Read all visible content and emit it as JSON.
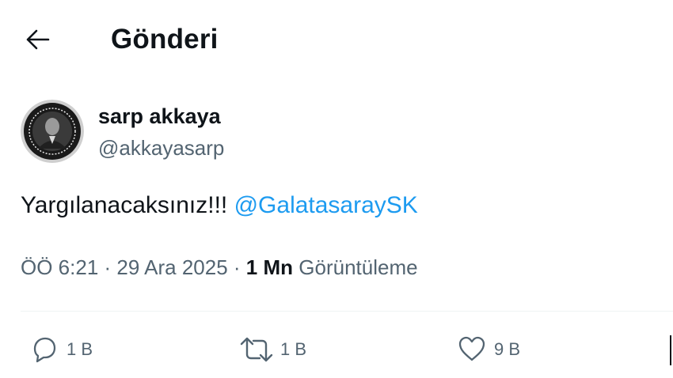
{
  "header": {
    "back_icon": "arrow-left-icon",
    "title": "Gönderi"
  },
  "author": {
    "avatar_icon": "profile-photo",
    "name": "sarp akkaya",
    "handle": "@akkayasarp"
  },
  "tweet": {
    "text": "Yargılanacaksınız!!!",
    "mention": "@GalatasaraySK",
    "mention_color": "#1d9bf0"
  },
  "meta": {
    "time": "ÖÖ 6:21",
    "separator": "·",
    "date": "29 Ara 2025",
    "views_count": "1 Mn",
    "views_label": "Görüntüleme"
  },
  "actions": {
    "reply": {
      "icon": "reply-icon",
      "count": "1 B"
    },
    "retweet": {
      "icon": "retweet-icon",
      "count": "1 B"
    },
    "like": {
      "icon": "heart-icon",
      "count": "9 B"
    }
  },
  "colors": {
    "text": "#0f1419",
    "secondary": "#536471",
    "accent": "#1d9bf0",
    "divider": "#eff3f4"
  }
}
